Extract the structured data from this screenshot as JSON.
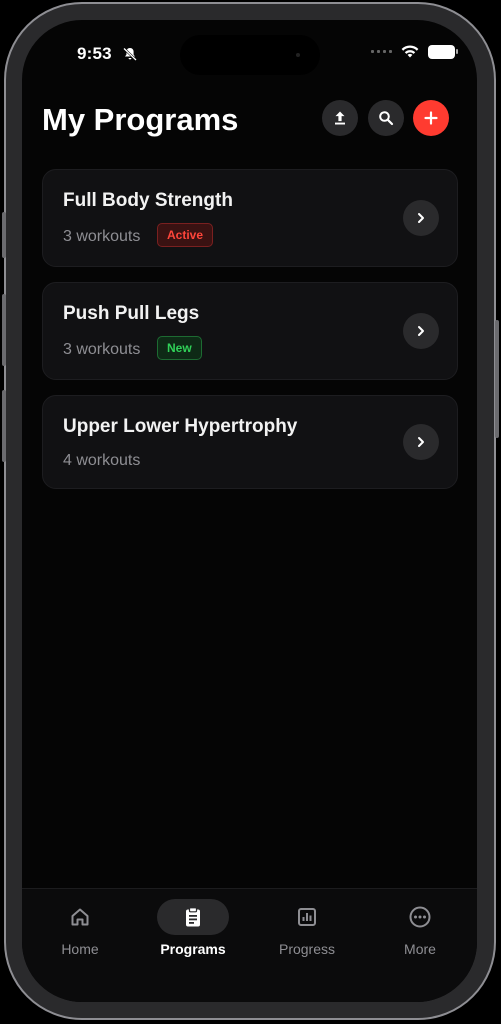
{
  "status_bar": {
    "time": "9:53"
  },
  "header": {
    "title": "My Programs"
  },
  "programs": [
    {
      "name": "Full Body Strength",
      "workouts": "3 workouts",
      "badge": "Active"
    },
    {
      "name": "Push Pull Legs",
      "workouts": "3 workouts",
      "badge": "New"
    },
    {
      "name": "Upper Lower Hypertrophy",
      "workouts": "4 workouts",
      "badge": ""
    }
  ],
  "tabs": [
    {
      "label": "Home",
      "icon": "home-icon"
    },
    {
      "label": "Programs",
      "icon": "clipboard-icon",
      "selected": true
    },
    {
      "label": "Progress",
      "icon": "bar-chart-icon"
    },
    {
      "label": "More",
      "icon": "more-icon"
    }
  ],
  "colors": {
    "accent": "#ff3b30",
    "active_badge": "#ff453a",
    "new_badge": "#30d158",
    "background": "#050505"
  }
}
